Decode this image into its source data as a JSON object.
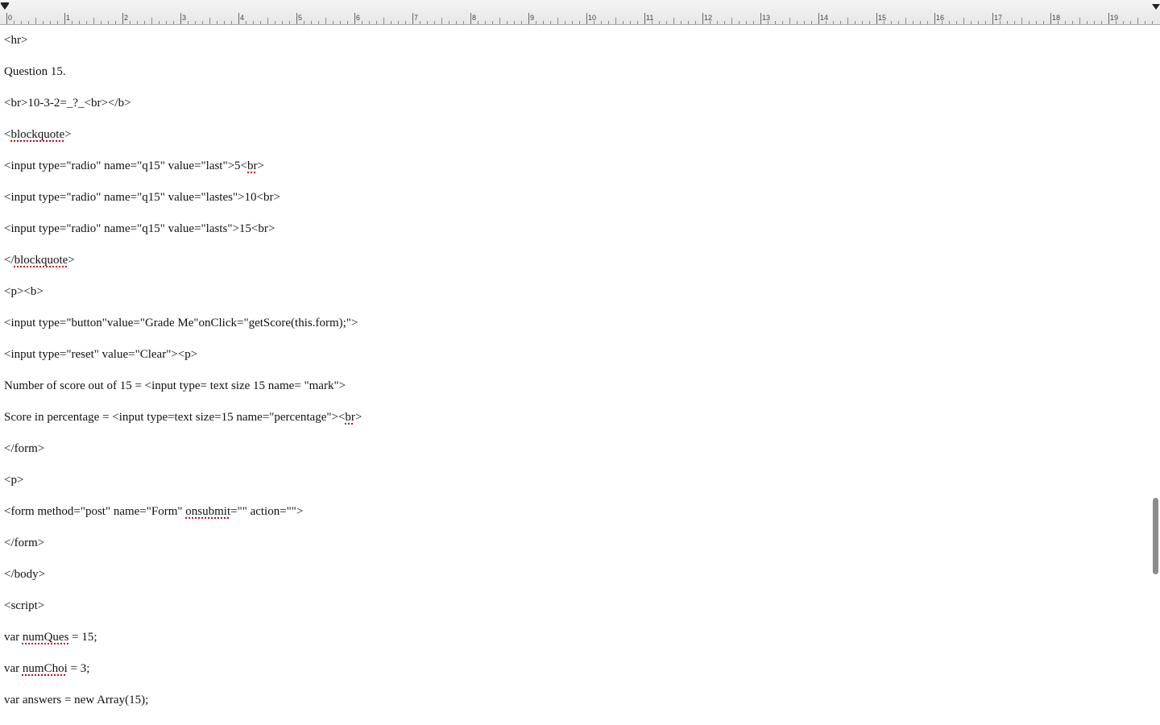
{
  "ruler": {
    "labels": [
      "0",
      "1",
      "2",
      "3",
      "4",
      "5",
      "6",
      "7",
      "8",
      "9",
      "10",
      "11",
      "12",
      "13",
      "14",
      "15",
      "16",
      "17",
      "18",
      "19"
    ]
  },
  "document": {
    "lines": [
      {
        "segments": [
          {
            "t": "<hr>"
          }
        ]
      },
      {
        "segments": [
          {
            "t": "Question 15."
          }
        ]
      },
      {
        "segments": [
          {
            "t": "<br>10-3-2=_?_<br></b>"
          }
        ]
      },
      {
        "segments": [
          {
            "t": "<"
          },
          {
            "t": "blockquote",
            "sp": true
          },
          {
            "t": ">"
          }
        ]
      },
      {
        "segments": [
          {
            "t": "<input type=\"radio\" name=\"q15\" value=\"last\">5<"
          },
          {
            "t": "br",
            "sp": true
          },
          {
            "t": ">"
          }
        ]
      },
      {
        "segments": [
          {
            "t": "<input type=\"radio\" name=\"q15\" value=\"lastes\">10<br>"
          }
        ]
      },
      {
        "segments": [
          {
            "t": "<input type=\"radio\" name=\"q15\" value=\"lasts\">15<br>"
          }
        ]
      },
      {
        "segments": [
          {
            "t": "</"
          },
          {
            "t": "blockquote",
            "sp": true
          },
          {
            "t": ">"
          }
        ]
      },
      {
        "segments": [
          {
            "t": "<p><b>"
          }
        ]
      },
      {
        "segments": [
          {
            "t": "<input type=\"button\"value=\"Grade Me\"onClick=\"getScore(this.form);\">"
          }
        ]
      },
      {
        "segments": [
          {
            "t": "<input type=\"reset\" value=\"Clear\"><p>"
          }
        ]
      },
      {
        "segments": [
          {
            "t": "Number of score out of 15 = <input type= text size 15 name= \"mark\">"
          }
        ]
      },
      {
        "segments": [
          {
            "t": "Score in percentage = <input type=text size=15 name=\"percentage\"><"
          },
          {
            "t": "br",
            "sp": true
          },
          {
            "t": ">"
          }
        ]
      },
      {
        "segments": [
          {
            "t": "</form>"
          }
        ]
      },
      {
        "segments": [
          {
            "t": "<p>"
          }
        ]
      },
      {
        "segments": [
          {
            "t": "<form method=\"post\" name=\"Form\" "
          },
          {
            "t": "onsubmit",
            "sp": true
          },
          {
            "t": "=\"\" action=\"\">"
          }
        ]
      },
      {
        "segments": [
          {
            "t": "</form>"
          }
        ]
      },
      {
        "segments": [
          {
            "t": "</body>"
          }
        ]
      },
      {
        "segments": [
          {
            "t": "<script>"
          }
        ]
      },
      {
        "segments": [
          {
            "t": "var "
          },
          {
            "t": "numQues",
            "sp": true
          },
          {
            "t": " = 15;"
          }
        ]
      },
      {
        "segments": [
          {
            "t": "var "
          },
          {
            "t": "numChoi",
            "sp": true
          },
          {
            "t": " = 3;"
          }
        ]
      },
      {
        "segments": [
          {
            "t": "var answers = new Array(15);"
          }
        ]
      }
    ]
  }
}
